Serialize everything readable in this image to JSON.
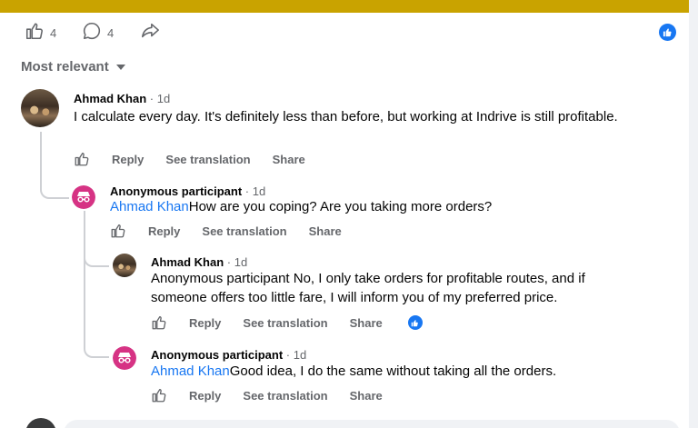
{
  "post_actions": {
    "like_count": "4",
    "comment_count": "4"
  },
  "sort": {
    "label": "Most relevant"
  },
  "comments": [
    {
      "author": "Ahmad Khan",
      "time": " · 1d",
      "text": "I calculate every day. It's definitely less than before, but working at Indrive is still profitable.",
      "reply": "Reply",
      "translate": "See translation",
      "share": "Share"
    },
    {
      "author": "Anonymous participant",
      "time": " · 1d",
      "mention": "Ahmad Khan",
      "text": "How are you coping? Are you taking more orders?",
      "reply": "Reply",
      "translate": "See translation",
      "share": "Share"
    },
    {
      "author": "Ahmad Khan",
      "time": " · 1d",
      "text": "Anonymous participant No, I only take orders for profitable routes, and if someone offers too little fare, I will inform you of my preferred price.",
      "reply": "Reply",
      "translate": "See translation",
      "share": "Share"
    },
    {
      "author": "Anonymous participant",
      "time": " · 1d",
      "mention": "Ahmad Khan",
      "text": "Good idea, I do the same without taking all the orders.",
      "reply": "Reply",
      "translate": "See translation",
      "share": "Share"
    }
  ],
  "colors": {
    "accent": "#1877f2",
    "banner": "#c9a300",
    "muted": "#65676b",
    "anon_avatar": "#d63384"
  }
}
